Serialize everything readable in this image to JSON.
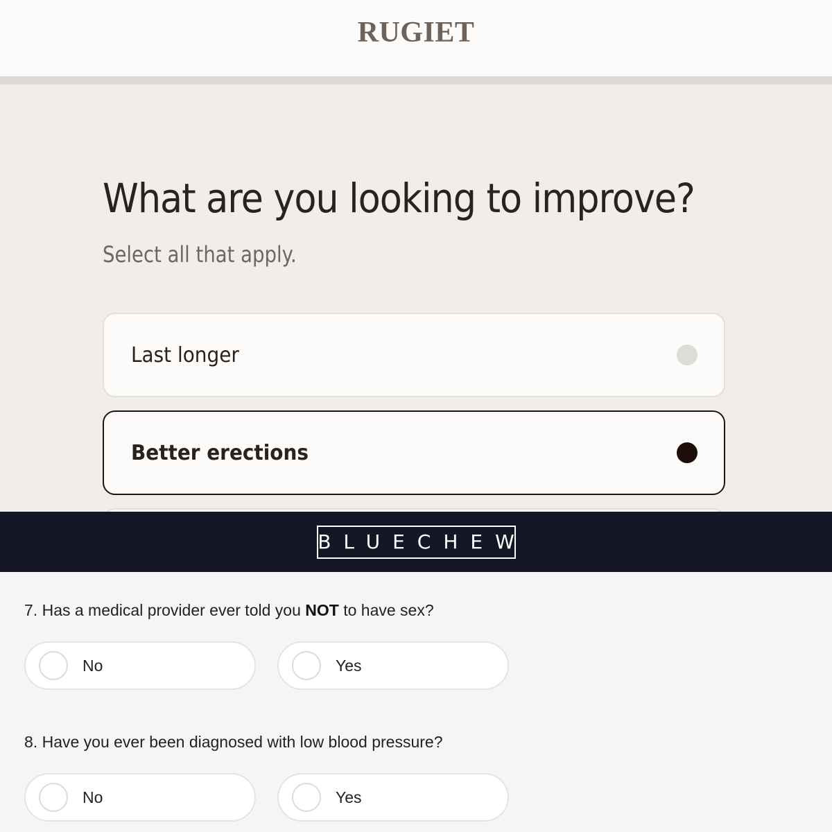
{
  "rugiet": {
    "logo": "RUGIET",
    "title": "What are you looking to improve?",
    "subtitle": "Select all that apply.",
    "options": [
      {
        "label": "Last longer",
        "selected": false
      },
      {
        "label": "Better erections",
        "selected": true
      }
    ],
    "colors": {
      "background": "#f1eeea",
      "selected_border": "#1c1512",
      "selected_dot": "#1c0d08",
      "unselected_dot": "#dedcd9"
    }
  },
  "bluechew": {
    "logo": "BLUECHEW",
    "colors": {
      "header": "#151726"
    },
    "questions": [
      {
        "number": "7.",
        "text_before": "Has a medical provider ever told you",
        "text_bold": "NOT",
        "text_after": "to have sex?",
        "options": [
          "No",
          "Yes"
        ]
      },
      {
        "number": "8.",
        "text": "Have you ever been diagnosed with low blood pressure?",
        "options": [
          "No",
          "Yes"
        ]
      }
    ]
  }
}
